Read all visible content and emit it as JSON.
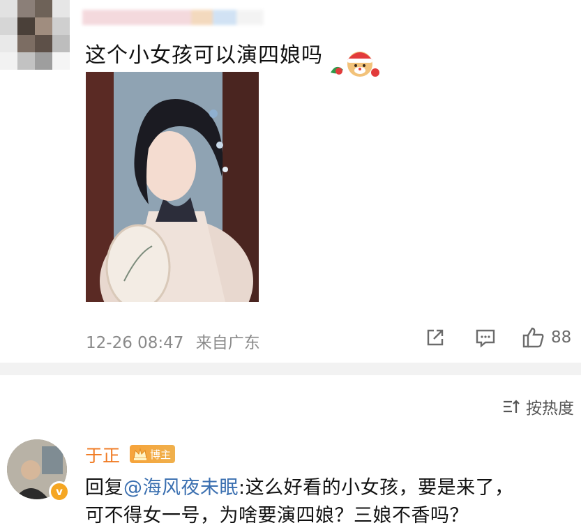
{
  "post": {
    "comment": "这个小女孩可以演四娘吗",
    "sticker_icon": "santa-bear-sticker",
    "photo_icon": "portrait-photo",
    "timestamp": "12-26 08:47",
    "location": "来自广东",
    "share_icon": "share-icon",
    "comment_icon": "comment-icon",
    "like_icon": "thumbs-up-icon",
    "like_count": "88"
  },
  "comments_header": {
    "sort_label": "按热度",
    "sort_icon": "sort-icon"
  },
  "reply": {
    "author": "于正",
    "badge": "博主",
    "reply_prefix": "回复",
    "mention": "@海风夜未眠",
    "text_line1": ":这么好看的小女孩，要是来了，",
    "text_line2": "可不得女一号，为啥要演四娘？三娘不香吗？",
    "verified_mark": "v"
  },
  "colors": {
    "accent_orange": "#f07a22",
    "mention_blue": "#3a6fb0",
    "meta_gray": "#8a8a8a"
  }
}
